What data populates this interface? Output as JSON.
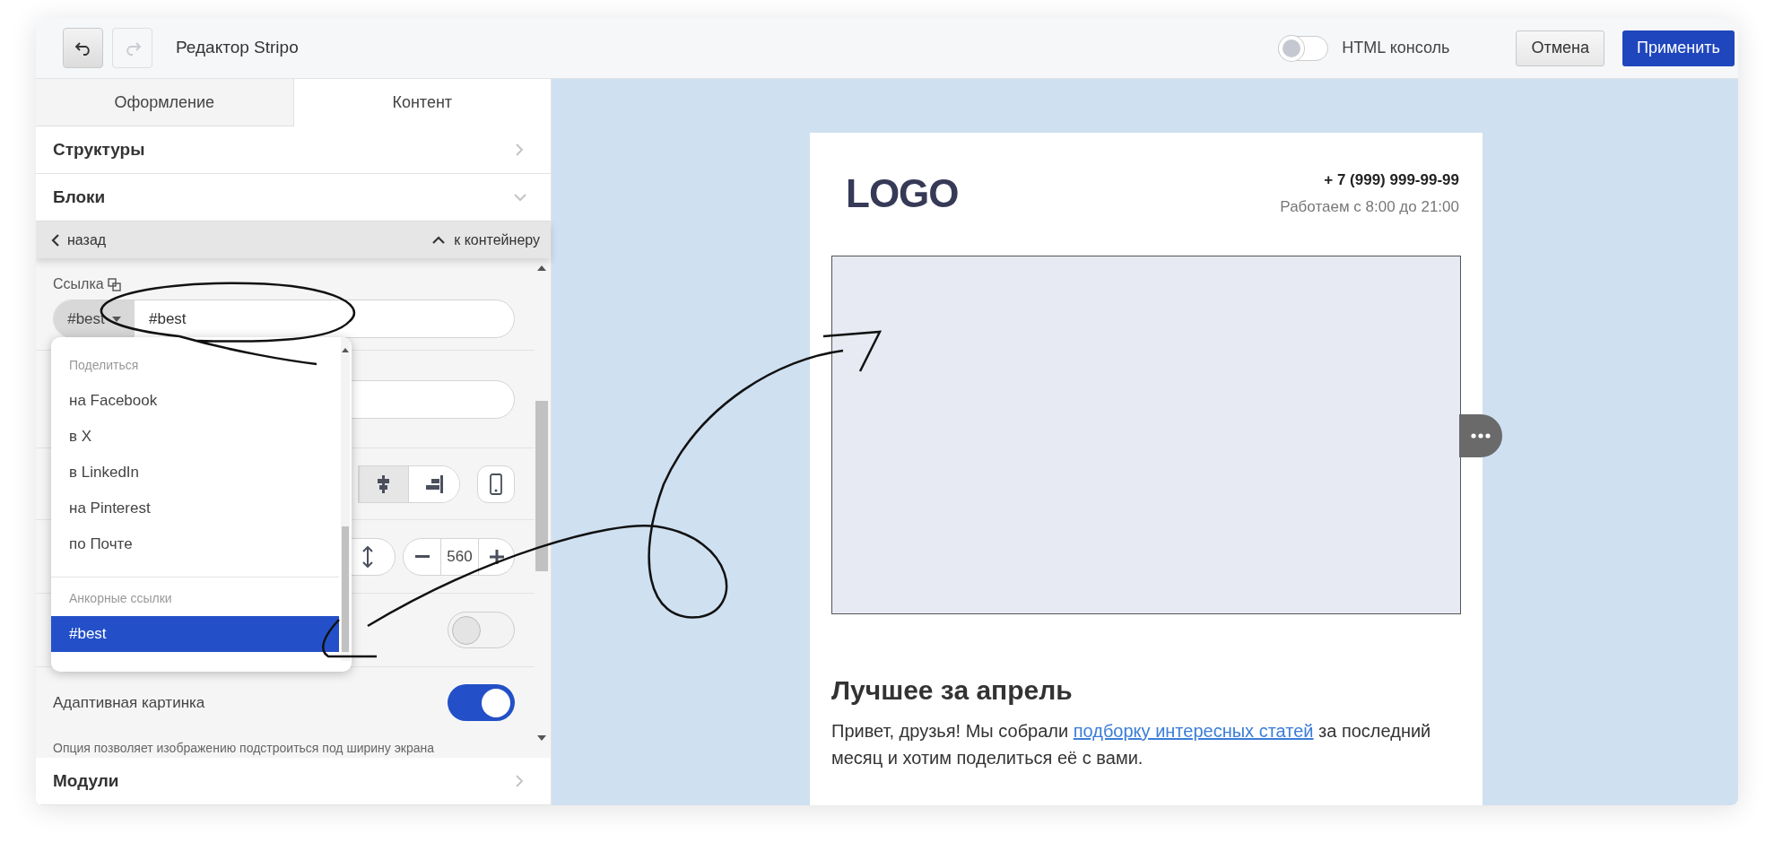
{
  "toolbar": {
    "undo": {
      "disabled": false
    },
    "redo": {
      "disabled": true
    },
    "title": "Редактор Stripo",
    "html_console": {
      "label": "HTML консоль",
      "on": false
    },
    "buttons": [
      {
        "label": "Отмена",
        "kind": "secondary"
      },
      {
        "label": "Применить",
        "kind": "primary"
      }
    ]
  },
  "tabs": [
    {
      "label": "Оформление",
      "selected": false
    },
    {
      "label": "Контент",
      "selected": true
    }
  ],
  "sections": [
    {
      "label": "Структуры",
      "expanded": false
    },
    {
      "label": "Блоки",
      "expanded": true
    }
  ],
  "block_nav": {
    "back": "назад",
    "container": "к контейнеру"
  },
  "link_field": {
    "label": "Ссылка",
    "prefix": "#best",
    "value": "#best"
  },
  "alignment": [
    {
      "kind": "center",
      "selected": true
    },
    {
      "kind": "right",
      "selected": false
    }
  ],
  "width_stepper": {
    "value": "560"
  },
  "hidden_toggle": {
    "on": false
  },
  "adaptive_image": {
    "label": "Адаптивная картинка",
    "on": true,
    "hint": "Опция позволяет изображению подстроиться под ширину экрана"
  },
  "modules_section": {
    "label": "Модули",
    "expanded": false
  },
  "dropdown": {
    "groups": [
      {
        "header": "Поделиться",
        "items": [
          {
            "label": "на Facebook",
            "selected": false
          },
          {
            "label": "в X",
            "selected": false
          },
          {
            "label": "в LinkedIn",
            "selected": false
          },
          {
            "label": "на Pinterest",
            "selected": false
          },
          {
            "label": "по Почте",
            "selected": false
          }
        ]
      },
      {
        "header": "Анкорные ссылки",
        "items": [
          {
            "label": "#best",
            "selected": true
          }
        ]
      }
    ]
  },
  "email_preview": {
    "logo": "LOGO",
    "phone": "+ 7 (999) 999-99-99",
    "hours": "Работаем с 8:00 до 21:00",
    "heading": "Лучшее за апрель",
    "paragraph": {
      "before": "Привет, друзья! Мы собрали ",
      "link": "подборку интересных статей",
      "after": " за последний месяц и хотим поделиться её с вами."
    }
  }
}
